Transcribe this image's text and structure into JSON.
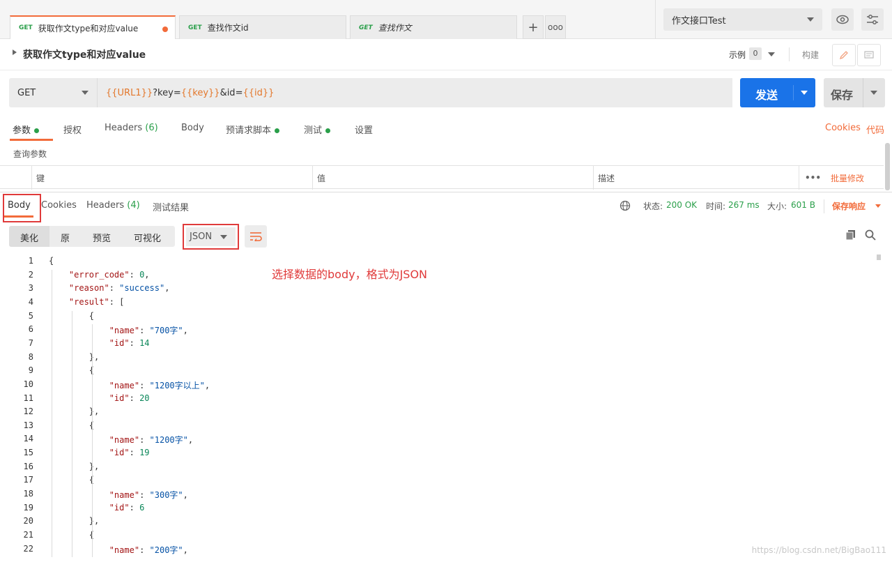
{
  "tabs": [
    {
      "method": "GET",
      "label": "获取作文type和对应value"
    },
    {
      "method": "GET",
      "label": "查找作文id"
    },
    {
      "method": "GET",
      "label": "查找作文"
    }
  ],
  "environment": "作文接口Test",
  "request": {
    "title": "获取作文type和对应value",
    "examples_label": "示例",
    "examples_count": "0",
    "build_label": "构建",
    "method": "GET",
    "url_parts": {
      "v1": "{{URL1}}",
      "t1": "?key=",
      "v2": "{{key}}",
      "t2": "&id=",
      "v3": "{{id}}"
    },
    "send_label": "发送",
    "save_label": "保存"
  },
  "request_tabs": {
    "params": "参数",
    "auth": "授权",
    "headers": "Headers",
    "headers_count": "(6)",
    "body": "Body",
    "prerequest": "预请求脚本",
    "tests": "测试",
    "settings": "设置",
    "cookies": "Cookies",
    "code": "代码"
  },
  "params": {
    "section_label": "查询参数",
    "col_key": "键",
    "col_value": "值",
    "col_desc": "描述",
    "bulk_edit": "批量修改"
  },
  "response": {
    "tab_body": "Body",
    "tab_cookies": "Cookies",
    "tab_headers": "Headers",
    "headers_count": "(4)",
    "tab_tests": "测试结果",
    "status_label": "状态:",
    "status_value": "200 OK",
    "time_label": "时间:",
    "time_value": "267 ms",
    "size_label": "大小:",
    "size_value": "601 B",
    "save_response": "保存响应",
    "view_pretty": "美化",
    "view_raw": "原",
    "view_preview": "预览",
    "view_visualize": "可视化",
    "format": "JSON"
  },
  "annotation": "选择数据的body，格式为JSON",
  "watermark": "https://blog.csdn.net/BigBao111",
  "json_lines": [
    "{",
    "    \"error_code\": 0,",
    "    \"reason\": \"success\",",
    "    \"result\": [",
    "        {",
    "            \"name\": \"700字\",",
    "            \"id\": 14",
    "        },",
    "        {",
    "            \"name\": \"1200字以上\",",
    "            \"id\": 20",
    "        },",
    "        {",
    "            \"name\": \"1200字\",",
    "            \"id\": 19",
    "        },",
    "        {",
    "            \"name\": \"300字\",",
    "            \"id\": 6",
    "        },",
    "        {",
    "            \"name\": \"200字\","
  ],
  "colors": {
    "accent": "#f26b3a",
    "send": "#1a73e8",
    "green": "#2a9f4a",
    "annot": "#e03a3a"
  }
}
